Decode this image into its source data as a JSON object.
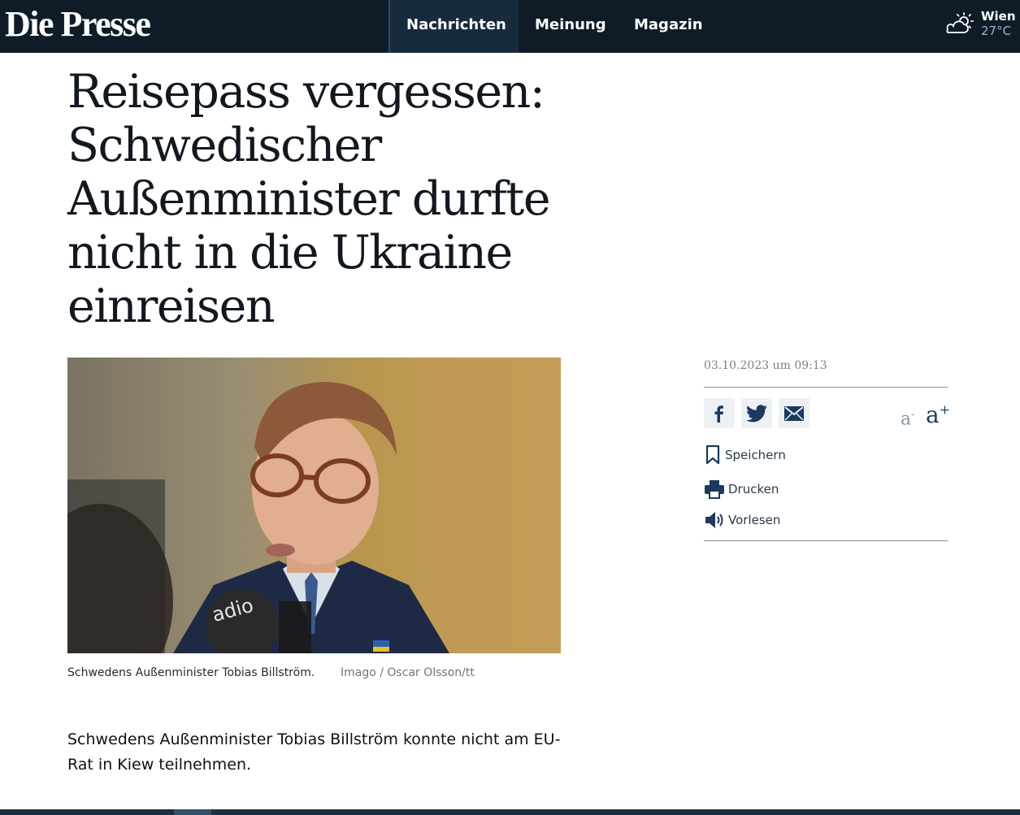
{
  "header": {
    "logo": "Die Presse",
    "nav": [
      "Nachrichten",
      "Meinung",
      "Magazin"
    ],
    "weather": {
      "city": "Wien",
      "temp": "27°C",
      "icon": "partly-cloudy-icon"
    }
  },
  "article": {
    "headline": "Reisepass vergessen: Schwedischer Außenminister durfte nicht in die Ukraine einreisen",
    "image_caption": "Schwedens Außenminister Tobias Billström.",
    "image_credit": "Imago / Oscar Olsson/tt",
    "teaser": "Schwedens Außenminister Tobias Billström konnte nicht am EU-Rat in Kiew teilnehmen."
  },
  "sidebar": {
    "date": "03.10.2023 um 09:13",
    "share": [
      "facebook-icon",
      "twitter-icon",
      "mail-icon"
    ],
    "font_size": {
      "decrease": "a",
      "decrease_sup": "-",
      "increase": "a",
      "increase_sup": "+"
    },
    "actions": [
      {
        "label": "Speichern",
        "icon": "bookmark-icon"
      },
      {
        "label": "Drucken",
        "icon": "printer-icon"
      },
      {
        "label": "Vorlesen",
        "icon": "speaker-icon"
      }
    ]
  },
  "colors": {
    "header_bg": "#0f1c28",
    "accent": "#1a3a5e"
  }
}
